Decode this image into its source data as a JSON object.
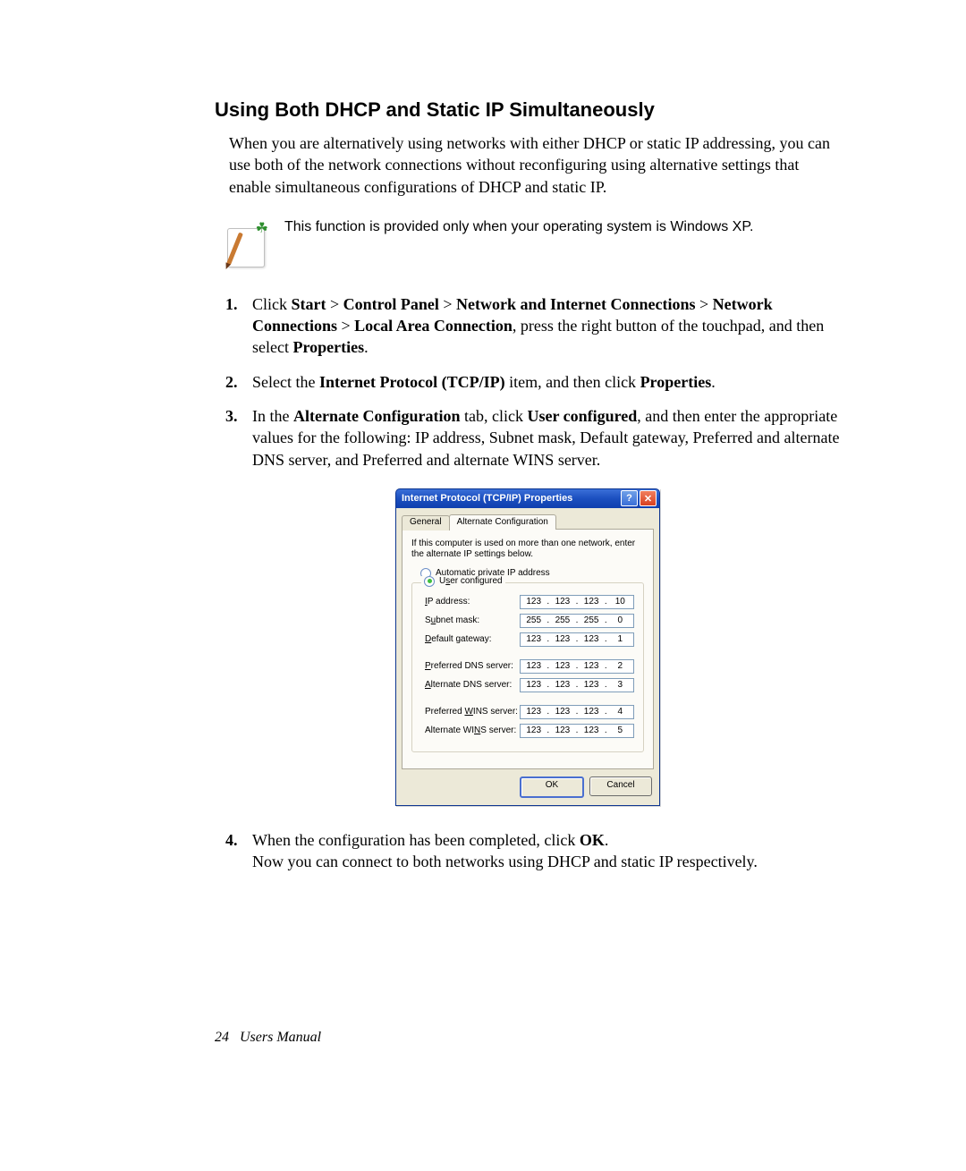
{
  "heading": "Using Both DHCP and Static IP Simultaneously",
  "intro": "When you are alternatively using networks with either DHCP or static IP addressing, you can use both of the network connections without reconfiguring using alternative settings that enable simultaneous configurations of DHCP and static IP.",
  "note": "This function is provided only when your operating system is Windows XP.",
  "steps": {
    "s1_prefix": "Click ",
    "s1_b1": "Start",
    "s1_gt": " > ",
    "s1_b2": "Control Panel",
    "s1_b3": "Network and Internet Connections",
    "s1_b4": "Network Connections",
    "s1_b5": "Local Area Connection",
    "s1_mid": ", press the right button of the touchpad, and then select ",
    "s1_b6": "Properties",
    "s1_end": ".",
    "s2_a": "Select the ",
    "s2_b1": "Internet Protocol (TCP/IP)",
    "s2_b": " item, and then click ",
    "s2_b2": "Properties",
    "s2_c": ".",
    "s3_a": "In the ",
    "s3_b1": "Alternate Configuration",
    "s3_b": " tab, click ",
    "s3_b2": "User configured",
    "s3_c": ", and then enter the appropriate values for the following: IP address, Subnet mask, Default gateway, Preferred and alternate DNS server, and Preferred and alternate WINS server.",
    "s4_a": "When the configuration has been completed, click ",
    "s4_b1": "OK",
    "s4_b": ".",
    "s4_line2": "Now you can connect to both networks using DHCP and static IP respectively."
  },
  "dialog": {
    "title": "Internet Protocol (TCP/IP) Properties",
    "tabs": {
      "general": "General",
      "alt": "Alternate Configuration"
    },
    "panel_note": "If this computer is used on more than one network, enter the alternate IP settings below.",
    "radio_auto": "Automatic private IP address",
    "radio_user": "User configured",
    "labels": {
      "ip": "IP address:",
      "subnet": "Subnet mask:",
      "gateway": "Default gateway:",
      "pdns": "Preferred DNS server:",
      "adns": "Alternate DNS server:",
      "pwins": "Preferred WINS server:",
      "awins": "Alternate WINS server:"
    },
    "letters": {
      "ip": "I",
      "subnet": "u",
      "gateway": "D",
      "pdns": "P",
      "adns": "A",
      "pwins": "W",
      "awins": "N"
    },
    "values": {
      "ip": [
        "123",
        "123",
        "123",
        "10"
      ],
      "subnet": [
        "255",
        "255",
        "255",
        "0"
      ],
      "gateway": [
        "123",
        "123",
        "123",
        "1"
      ],
      "pdns": [
        "123",
        "123",
        "123",
        "2"
      ],
      "adns": [
        "123",
        "123",
        "123",
        "3"
      ],
      "pwins": [
        "123",
        "123",
        "123",
        "4"
      ],
      "awins": [
        "123",
        "123",
        "123",
        "5"
      ]
    },
    "ok": "OK",
    "cancel": "Cancel"
  },
  "footer": {
    "page": "24",
    "label": "Users Manual"
  }
}
